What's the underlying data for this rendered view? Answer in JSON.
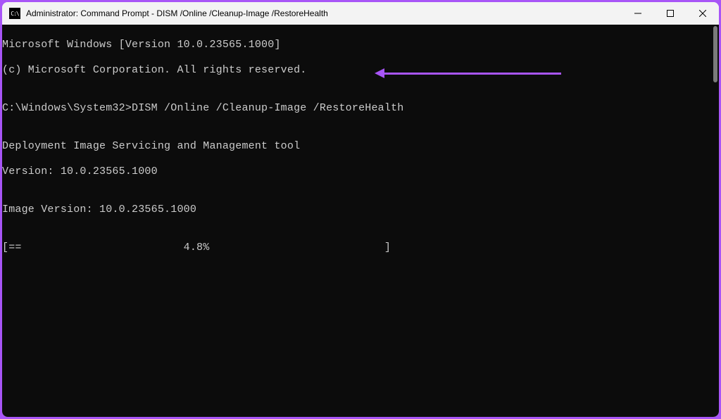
{
  "titlebar": {
    "icon_text": "C:\\",
    "title": "Administrator: Command Prompt - DISM  /Online /Cleanup-Image /RestoreHealth"
  },
  "console": {
    "line1": "Microsoft Windows [Version 10.0.23565.1000]",
    "line2": "(c) Microsoft Corporation. All rights reserved.",
    "line3": "",
    "prompt_line": "C:\\Windows\\System32>DISM /Online /Cleanup-Image /RestoreHealth",
    "line5": "",
    "line6": "Deployment Image Servicing and Management tool",
    "line7": "Version: 10.0.23565.1000",
    "line8": "",
    "line9": "Image Version: 10.0.23565.1000",
    "line10": "",
    "progress_line": "[==                         4.8%                           ]"
  },
  "annotation": {
    "arrow_color": "#a855f7"
  }
}
